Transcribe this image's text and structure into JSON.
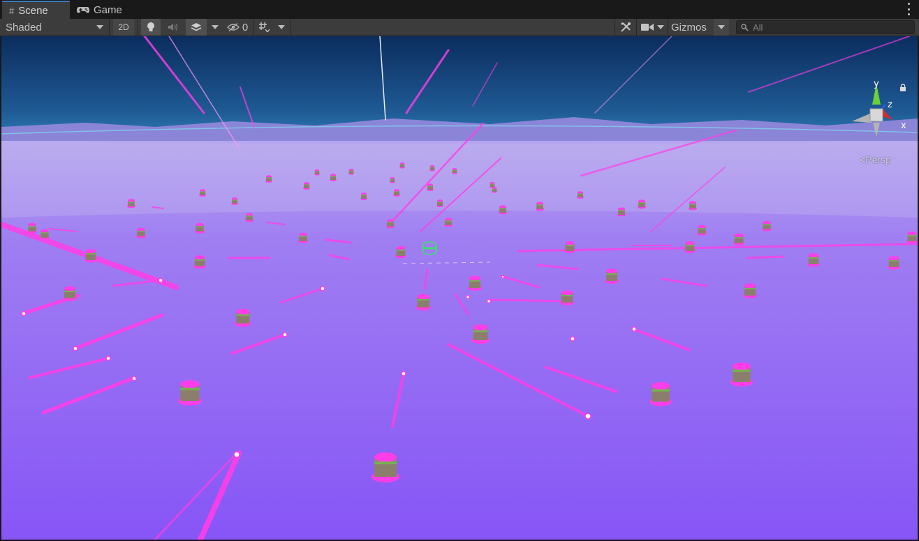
{
  "tabs": [
    {
      "label": "Scene",
      "icon": "hash-icon"
    },
    {
      "label": "Game",
      "icon": "gamepad-icon"
    }
  ],
  "toolbar": {
    "draw_mode": "Shaded",
    "two_d_label": "2D",
    "hidden_count": "0",
    "gizmos_label": "Gizmos",
    "search_placeholder": "All"
  },
  "orientation_gizmo": {
    "y_label": "y",
    "z_label": "z",
    "x_label": "x",
    "projection_label": "Persp",
    "colors": {
      "y": "#6ad13a",
      "z": "#2a5ee8",
      "x": "#d42a2a"
    }
  },
  "scene": {
    "sky_top": "#0b2d5e",
    "horizon": "#2f8ac3",
    "ground": "#8d59f5",
    "beam_color": "#ff3ee8",
    "turret_color": "#9a8a74"
  }
}
